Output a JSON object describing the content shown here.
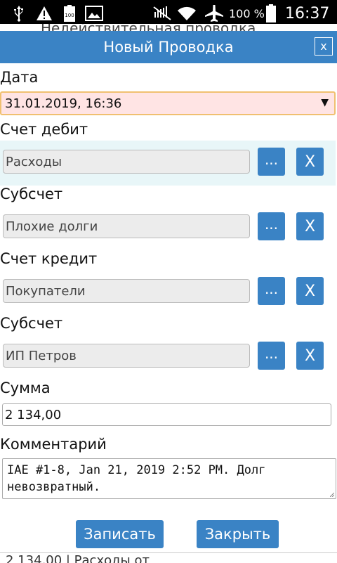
{
  "statusbar": {
    "battery_percent": "100 %",
    "clock": "16:37",
    "icons": [
      "usb-icon",
      "alert-icon",
      "battery-full-small-icon",
      "image-icon",
      "mute-icon",
      "wifi-icon",
      "airplane-icon",
      "battery-icon"
    ]
  },
  "background": {
    "top_text": "Недействительная проводка",
    "bottom_text": "2 134,00 | Расходы от"
  },
  "dialog": {
    "title": "Новый Проводка",
    "close_label": "x",
    "date_label": "Дата",
    "date_value": "31.01.2019, 16:36",
    "debit_label": "Счет дебит",
    "debit_value": "Расходы",
    "debit_sub_label": "Субсчет",
    "debit_sub_value": "Плохие долги",
    "credit_label": "Счет кредит",
    "credit_value": "Покупатели",
    "credit_sub_label": "Субсчет",
    "credit_sub_value": "ИП Петров",
    "pick_label": "...",
    "clear_label": "X",
    "sum_label": "Сумма",
    "sum_value": "2 134,00",
    "comment_label": "Комментарий",
    "comment_value": "IAE #1-8, Jan 21, 2019 2:52 PM. Долг\nневозвратный.",
    "save_label": "Записать",
    "close_button_label": "Закрыть"
  },
  "colors": {
    "accent": "#3a83c5",
    "date_bg": "#ffe4e4",
    "date_border": "#f0c070",
    "highlight_row": "#e8f6f8"
  }
}
